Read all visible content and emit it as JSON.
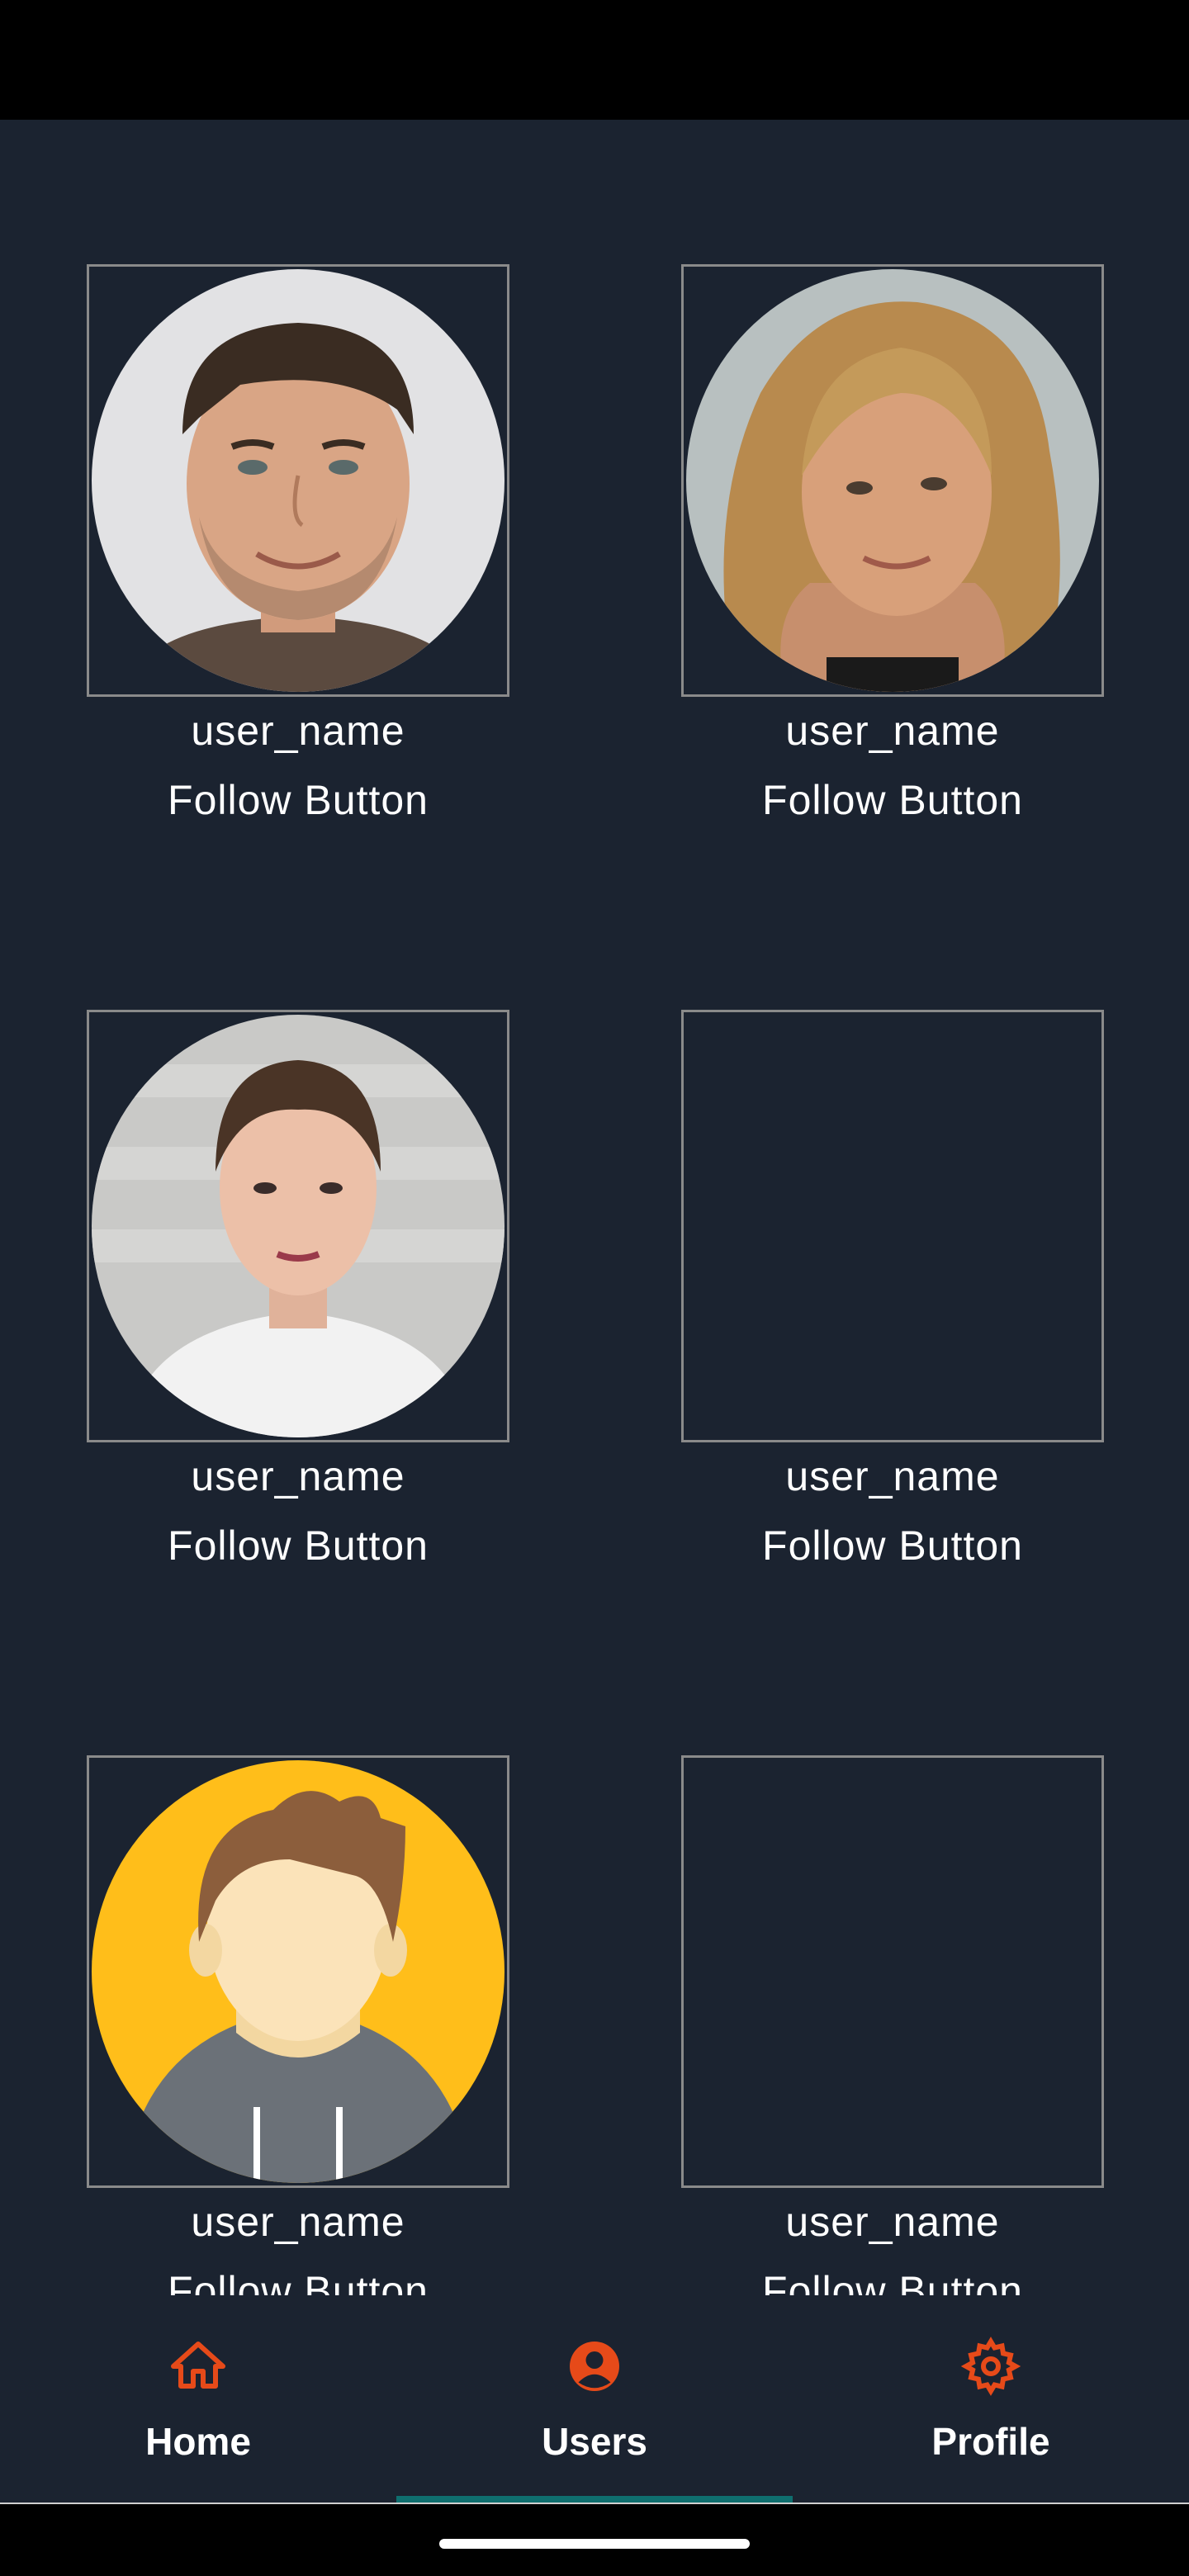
{
  "users": [
    {
      "username": "user_name",
      "follow_label": "Follow Button",
      "avatar": "man-photo"
    },
    {
      "username": "user_name",
      "follow_label": "Follow Button",
      "avatar": "woman-blonde-photo"
    },
    {
      "username": "user_name",
      "follow_label": "Follow Button",
      "avatar": "woman-brunette-photo"
    },
    {
      "username": "user_name",
      "follow_label": "Follow Button",
      "avatar": "empty"
    },
    {
      "username": "user_name",
      "follow_label": "Follow Button",
      "avatar": "cartoon-man-illustration"
    },
    {
      "username": "user_name",
      "follow_label": "Follow Button",
      "avatar": "empty"
    }
  ],
  "nav": {
    "home_label": "Home",
    "users_label": "Users",
    "profile_label": "Profile",
    "active": "Users",
    "accent_color": "#e64a19",
    "indicator_color": "#0f6e6e"
  },
  "colors": {
    "background": "#1b2330",
    "frame_border": "#8a8a8a"
  }
}
